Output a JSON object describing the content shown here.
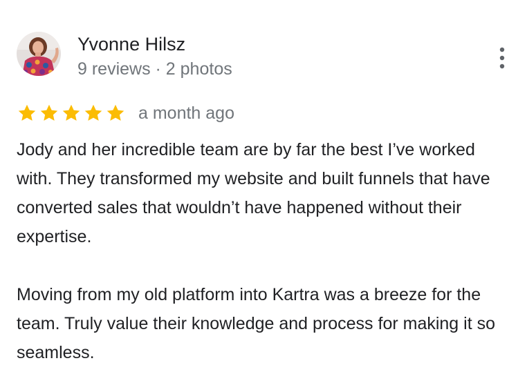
{
  "review": {
    "author": {
      "name": "Yvonne Hilsz",
      "meta": "9 reviews · 2 photos",
      "avatar_icon": "profile-photo"
    },
    "rating": 5,
    "max_rating": 5,
    "star_color": "#fbbc04",
    "date": "a month ago",
    "paragraphs": [
      "Jody and her incredible team are by far the best I’ve worked with. They transformed my website and built funnels that have converted sales that wouldn’t have happened without their expertise.",
      "Moving from my old platform into Kartra was a breeze for the team. Truly value their knowledge and process for making it so seamless."
    ],
    "more_icon": "more-vert-icon"
  }
}
